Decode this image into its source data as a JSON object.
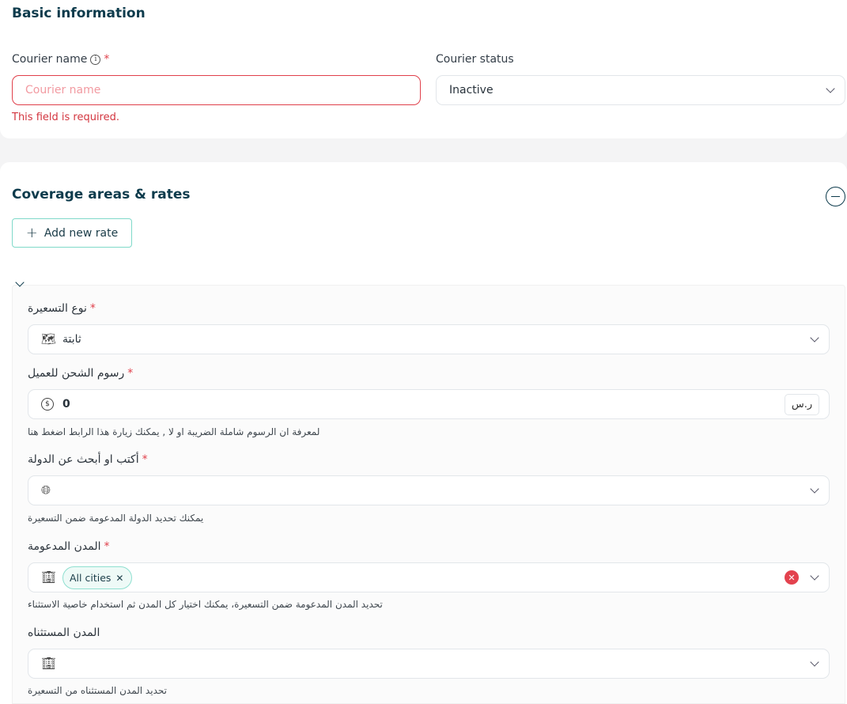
{
  "basic_info": {
    "title": "Basic information",
    "courier_name": {
      "label": "Courier name",
      "required_mark": "*",
      "placeholder": "Courier name",
      "error": "This field is required."
    },
    "courier_status": {
      "label": "Courier status",
      "value": "Inactive"
    }
  },
  "coverage": {
    "title": "Coverage areas & rates",
    "add_rate_label": "Add new rate",
    "rate": {
      "pricing_type": {
        "label": "نوع التسعيرة",
        "required_mark": "*",
        "value": "ثابتة",
        "icon": "map-icon"
      },
      "shipping_fee": {
        "label": "رسوم الشحن للعميل",
        "required_mark": "*",
        "value": "0",
        "currency": "ر.س",
        "hint": "لمعرفة ان الرسوم شاملة الضريبة او لا , يمكنك زيارة هذا الرابط اضغط هنا",
        "icon": "coin-icon"
      },
      "country": {
        "label": "أكتب او أبحث عن الدولة",
        "required_mark": "*",
        "hint": "يمكنك تحديد الدولة المدعومة ضمن التسعيرة",
        "icon": "globe-icon"
      },
      "supported_cities": {
        "label": "المدن المدعومة",
        "required_mark": "*",
        "chip": "All cities",
        "hint": "تحديد المدن المدعومة ضمن التسعيرة، يمكنك اختيار كل المدن ثم استخدام خاصية الاستثناء",
        "icon": "building-icon"
      },
      "excluded_cities": {
        "label": "المدن المستثناه",
        "hint": "تحديد المدن المستثناه من التسعيرة",
        "icon": "building-icon"
      }
    }
  },
  "colors": {
    "primary_dark": "#0d3b4c",
    "error": "#e0404b",
    "accent": "#7fd9c9"
  }
}
